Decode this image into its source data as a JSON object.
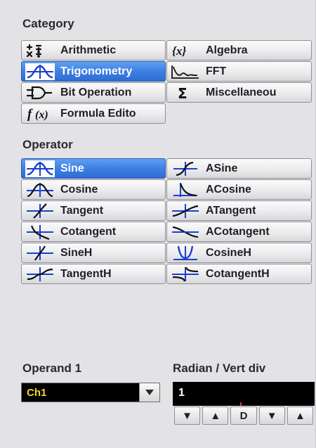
{
  "category": {
    "heading": "Category",
    "buttons": [
      {
        "label": "Arithmetic",
        "icon": "plus-minus-icon"
      },
      {
        "label": "Algebra",
        "icon": "variable-x-icon"
      },
      {
        "label": "Trigonometry",
        "icon": "sine-wave-icon"
      },
      {
        "label": "FFT",
        "icon": "fft-spectrum-icon"
      },
      {
        "label": "Bit Operation",
        "icon": "logic-gate-icon"
      },
      {
        "label": "Miscellaneou",
        "icon": "sigma-icon"
      },
      {
        "label": "Formula Edito",
        "icon": "function-fx-icon"
      }
    ],
    "selected": "Trigonometry"
  },
  "operator": {
    "heading": "Operator",
    "buttons": [
      {
        "label": "Sine",
        "icon": "sine-icon"
      },
      {
        "label": "ASine",
        "icon": "asine-icon"
      },
      {
        "label": "Cosine",
        "icon": "cosine-icon"
      },
      {
        "label": "ACosine",
        "icon": "acosine-icon"
      },
      {
        "label": "Tangent",
        "icon": "tangent-icon"
      },
      {
        "label": "ATangent",
        "icon": "atangent-icon"
      },
      {
        "label": "Cotangent",
        "icon": "cotangent-icon"
      },
      {
        "label": "ACotangent",
        "icon": "acotangent-icon"
      },
      {
        "label": "SineH",
        "icon": "sineh-icon"
      },
      {
        "label": "CosineH",
        "icon": "cosineh-icon"
      },
      {
        "label": "TangentH",
        "icon": "tangenth-icon"
      },
      {
        "label": "CotangentH",
        "icon": "cotangenth-icon"
      }
    ],
    "selected": "Sine"
  },
  "operand1": {
    "heading": "Operand 1",
    "value": "Ch1"
  },
  "radian": {
    "heading": "Radian / Vert div",
    "value": "1",
    "stepper": [
      "▼",
      "▲",
      "D",
      "▼",
      "▲"
    ]
  },
  "colors": {
    "selected": "#3d7fe4",
    "icon_blue": "#1a3fd0",
    "field_text": "#f0d820"
  }
}
